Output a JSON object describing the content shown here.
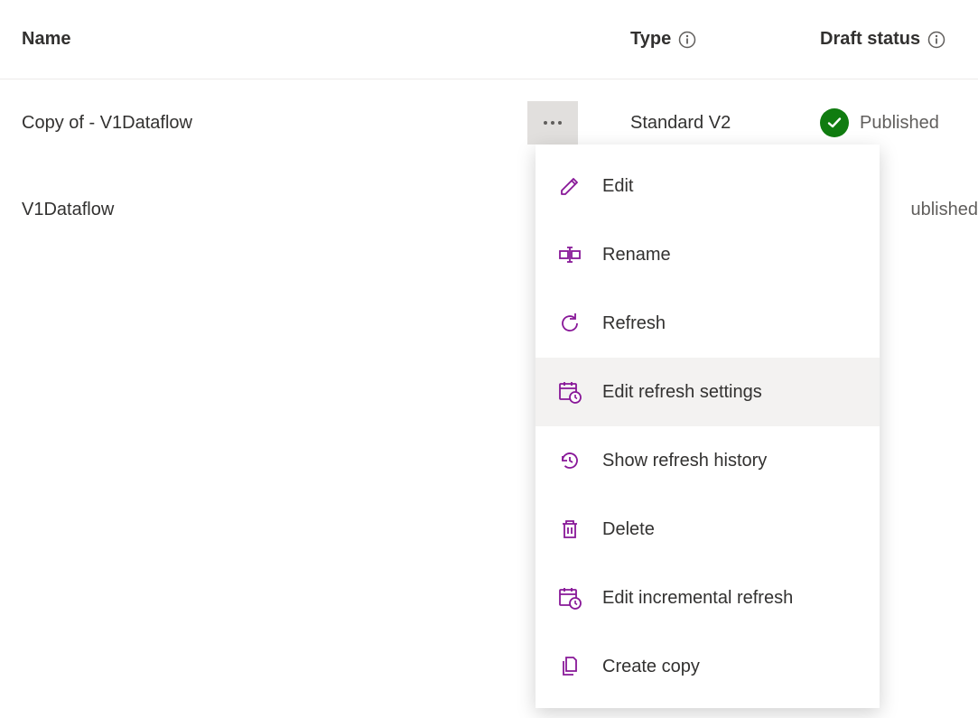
{
  "columns": {
    "name": "Name",
    "type": "Type",
    "status": "Draft status"
  },
  "rows": [
    {
      "name": "Copy of - V1Dataflow",
      "type": "Standard V2",
      "status": "Published",
      "menu_open": true
    },
    {
      "name": "V1Dataflow",
      "type": "",
      "status_tail": "ublished"
    }
  ],
  "menu": {
    "edit": "Edit",
    "rename": "Rename",
    "refresh": "Refresh",
    "edit_refresh_settings": "Edit refresh settings",
    "show_refresh_history": "Show refresh history",
    "delete": "Delete",
    "edit_incremental_refresh": "Edit incremental refresh",
    "create_copy": "Create copy"
  },
  "colors": {
    "accent": "#881798",
    "success": "#107c10"
  }
}
